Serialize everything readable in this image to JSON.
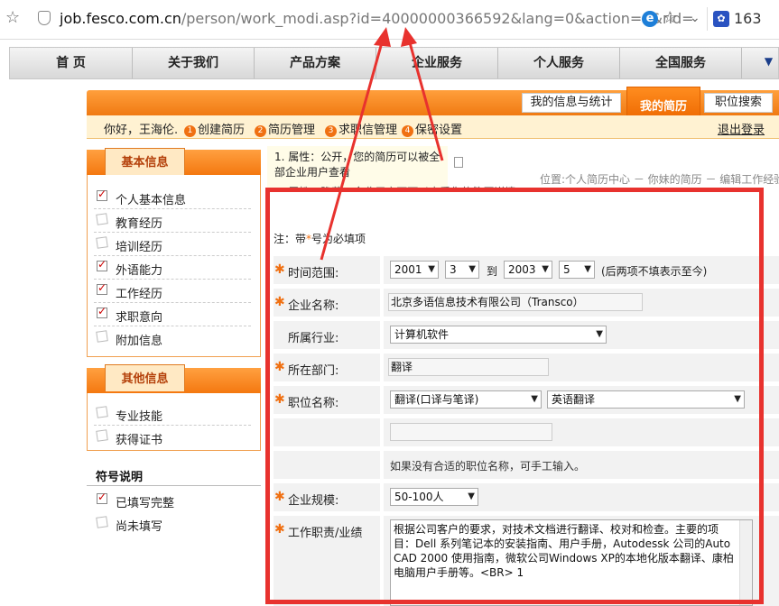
{
  "browser": {
    "url_host": "job.fesco.com.cn",
    "url_path": "/person/work_modi.asp?id=40000000366592&lang=0&action=1&rid=",
    "extension_count": "163"
  },
  "nav": {
    "items": [
      "首 页",
      "关于我们",
      "产品方案",
      "企业服务",
      "个人服务",
      "全国服务"
    ]
  },
  "header": {
    "tabs": [
      "我的信息与统计",
      "我的简历",
      "职位搜索"
    ],
    "greeting": "你好，王海伦.",
    "steps": [
      "创建简历",
      "简历管理",
      "求职信管理",
      "保密设置"
    ],
    "step_numbers": [
      "1",
      "2",
      "3",
      "4"
    ],
    "logout": "退出登录"
  },
  "sidebar": {
    "basic_title": "基本信息",
    "basic_items": [
      {
        "label": "个人基本信息",
        "done": true
      },
      {
        "label": "教育经历",
        "done": false
      },
      {
        "label": "培训经历",
        "done": false
      },
      {
        "label": "外语能力",
        "done": true
      },
      {
        "label": "工作经历",
        "done": true
      },
      {
        "label": "求职意向",
        "done": true
      },
      {
        "label": "附加信息",
        "done": false
      }
    ],
    "other_title": "其他信息",
    "other_items": [
      {
        "label": "专业技能",
        "done": false
      },
      {
        "label": "获得证书",
        "done": false
      }
    ],
    "legend_title": "符号说明",
    "legend_done": "已填写完整",
    "legend_todo": "尚未填写"
  },
  "notice": {
    "line1": "1. 属性：公开，您的简历可以被全",
    "line2": "部企业用户查看",
    "line3": "2. 属性：隐藏，企业用户不可以查看您的简历详情",
    "location": "位置:个人简历中心 － 你妹的简历 － 编辑工作经验"
  },
  "form": {
    "note": "注：带",
    "note_star": "*",
    "note_suffix": "号为必填项",
    "time_label": "时间范围:",
    "time_start_year": "2001",
    "time_start_month": "3",
    "time_to": "到",
    "time_end_year": "2003",
    "time_end_month": "5",
    "time_hint": "(后两项不填表示至今)",
    "company_label": "企业名称:",
    "company_value": "北京多语信息技术有限公司（Transco）",
    "industry_label": "所属行业:",
    "industry_value": "计算机软件",
    "dept_label": "所在部门:",
    "dept_value": "翻译",
    "position_label": "职位名称:",
    "position_value1": "翻译(口译与笔译)",
    "position_value2": "英语翻译",
    "position_manual": "",
    "position_hint": "如果没有合适的职位名称，可手工输入。",
    "size_label": "企业规模:",
    "size_value": "50-100人",
    "duty_label": "工作职责/业绩",
    "duty_value": "根据公司客户的要求，对技术文档进行翻译、校对和检查。主要的项目：Dell 系列笔记本的安装指南、用户手册，Autodessk 公司的Auto CAD 2000 使用指南，微软公司Windows XP的本地化版本翻译、康柏电脑用户手册等。<BR> 1"
  },
  "colors": {
    "orange": "#f07a12",
    "red_annotation": "#e8322e"
  }
}
